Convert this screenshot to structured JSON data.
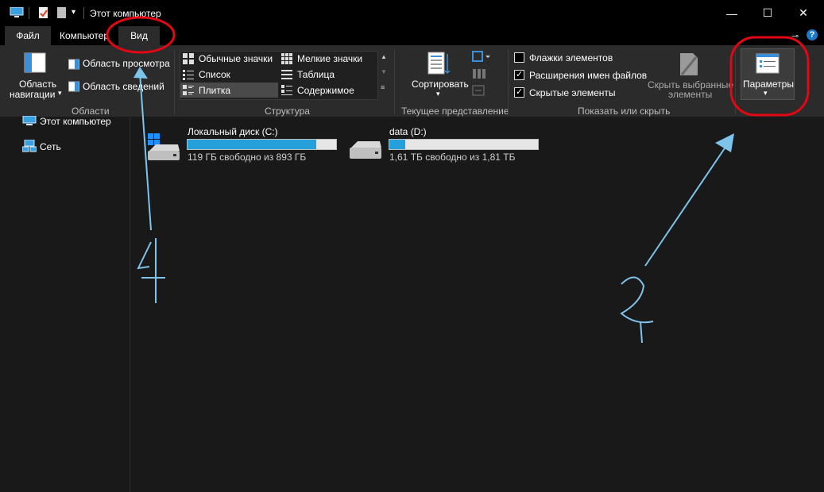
{
  "window": {
    "title": "Этот компьютер",
    "controls": {
      "minimize": "—",
      "maximize": "☐",
      "close": "✕"
    }
  },
  "tabs": [
    {
      "label": "Файл"
    },
    {
      "label": "Компьютер"
    },
    {
      "label": "Вид",
      "active": true
    }
  ],
  "ribbon": {
    "areas": {
      "nav_pane_label1": "Область",
      "nav_pane_label2": "навигации",
      "preview_pane": "Область просмотра",
      "details_pane": "Область сведений",
      "group": "Области"
    },
    "structure": {
      "items": [
        "Обычные значки",
        "Мелкие значки",
        "Список",
        "Таблица",
        "Плитка",
        "Содержимое"
      ],
      "selected": "Плитка",
      "group": "Структура"
    },
    "current_view": {
      "sort_label": "Сортировать",
      "group": "Текущее представление"
    },
    "show_hide": {
      "checkboxes": [
        {
          "label": "Флажки элементов",
          "checked": false
        },
        {
          "label": "Расширения имен файлов",
          "checked": true
        },
        {
          "label": "Скрытые элементы",
          "checked": true
        }
      ],
      "hide_selected_line1": "Скрыть выбранные",
      "hide_selected_line2": "элементы",
      "group": "Показать или скрыть"
    },
    "options_label": "Параметры"
  },
  "nav": {
    "items": [
      {
        "label": "Этот компьютер",
        "icon": "computer-icon"
      },
      {
        "label": "Сеть",
        "icon": "network-icon"
      }
    ]
  },
  "drives": [
    {
      "name": "Локальный диск (C:)",
      "free_text": "119 ГБ свободно из 893 ГБ",
      "used_fraction": 0.87
    },
    {
      "name": "data (D:)",
      "free_text": "1,61 ТБ свободно из 1,81 ТБ",
      "used_fraction": 0.11
    }
  ],
  "annotations": {
    "arrow1_number": "1",
    "arrow2_number": "2"
  },
  "colors": {
    "accent": "#26a0da",
    "annotation_red": "#e30613",
    "annotation_blue": "#7dc3ea"
  }
}
